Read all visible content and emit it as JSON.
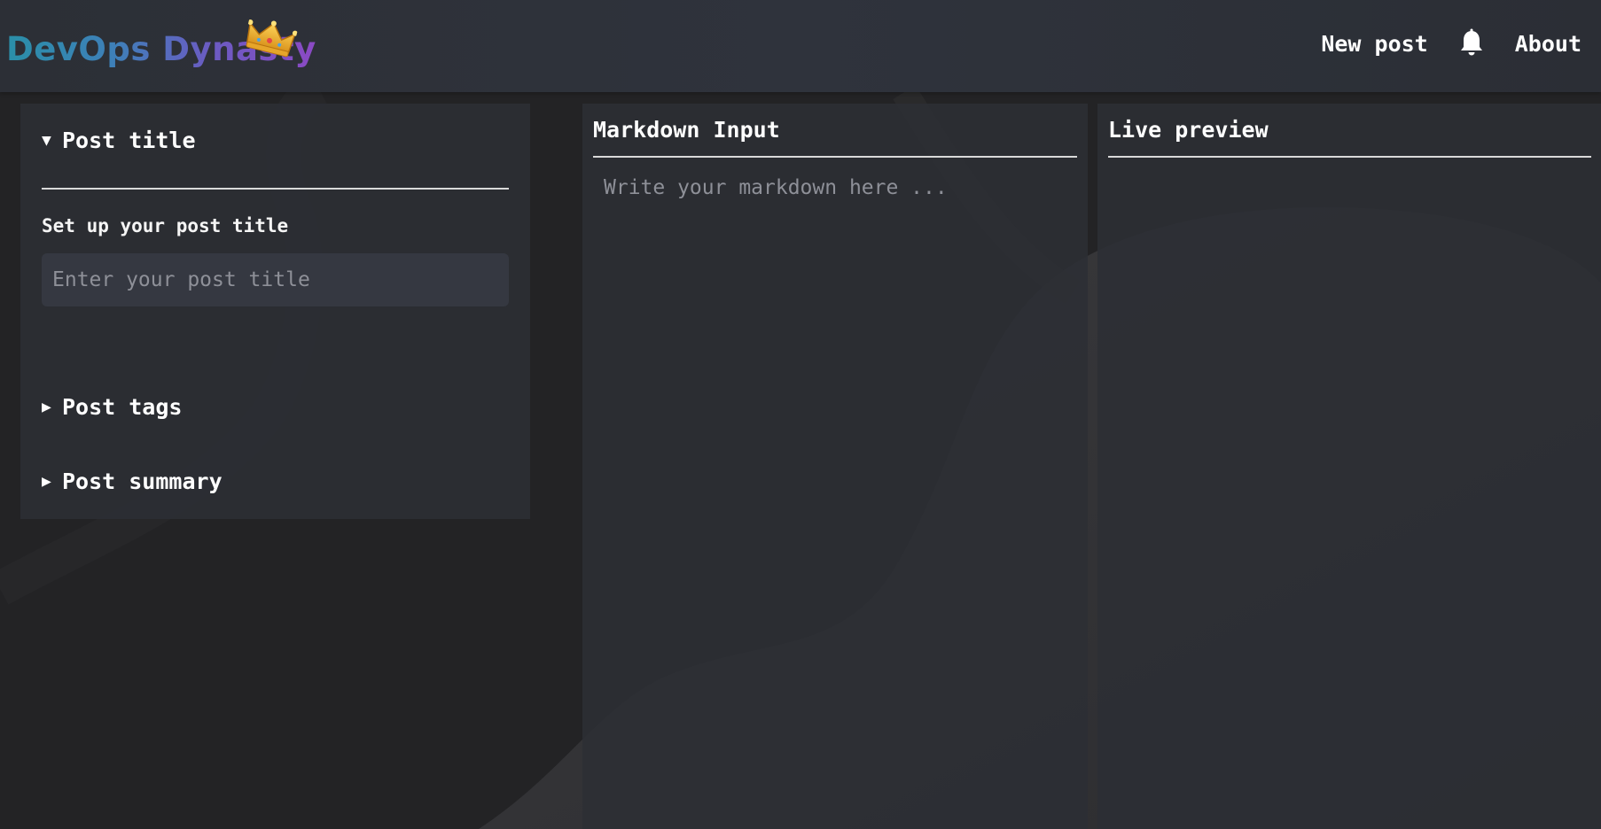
{
  "header": {
    "logo_text": "DevOps Dynasty",
    "nav": {
      "new_post": "New post",
      "about": "About"
    }
  },
  "sidebar": {
    "sections": [
      {
        "label": "Post title",
        "expanded": true
      },
      {
        "label": "Post tags",
        "expanded": false
      },
      {
        "label": "Post summary",
        "expanded": false
      }
    ],
    "title_field": {
      "label": "Set up your post title",
      "placeholder": "Enter your post title",
      "value": ""
    }
  },
  "editor": {
    "markdown_title": "Markdown Input",
    "markdown_placeholder": "Write your markdown here ...",
    "preview_title": "Live preview"
  },
  "icons": {
    "crown": "crown-icon",
    "bell": "bell-icon",
    "expanded_caret": "triangle-down-icon",
    "collapsed_caret": "triangle-right-icon"
  },
  "colors": {
    "background": "#232325",
    "header": "#2f333c",
    "panel": "#2c2e34",
    "input": "#353841",
    "logo_gradient": [
      "#2a8fa8",
      "#6a5cc2",
      "#8b49c4"
    ]
  }
}
